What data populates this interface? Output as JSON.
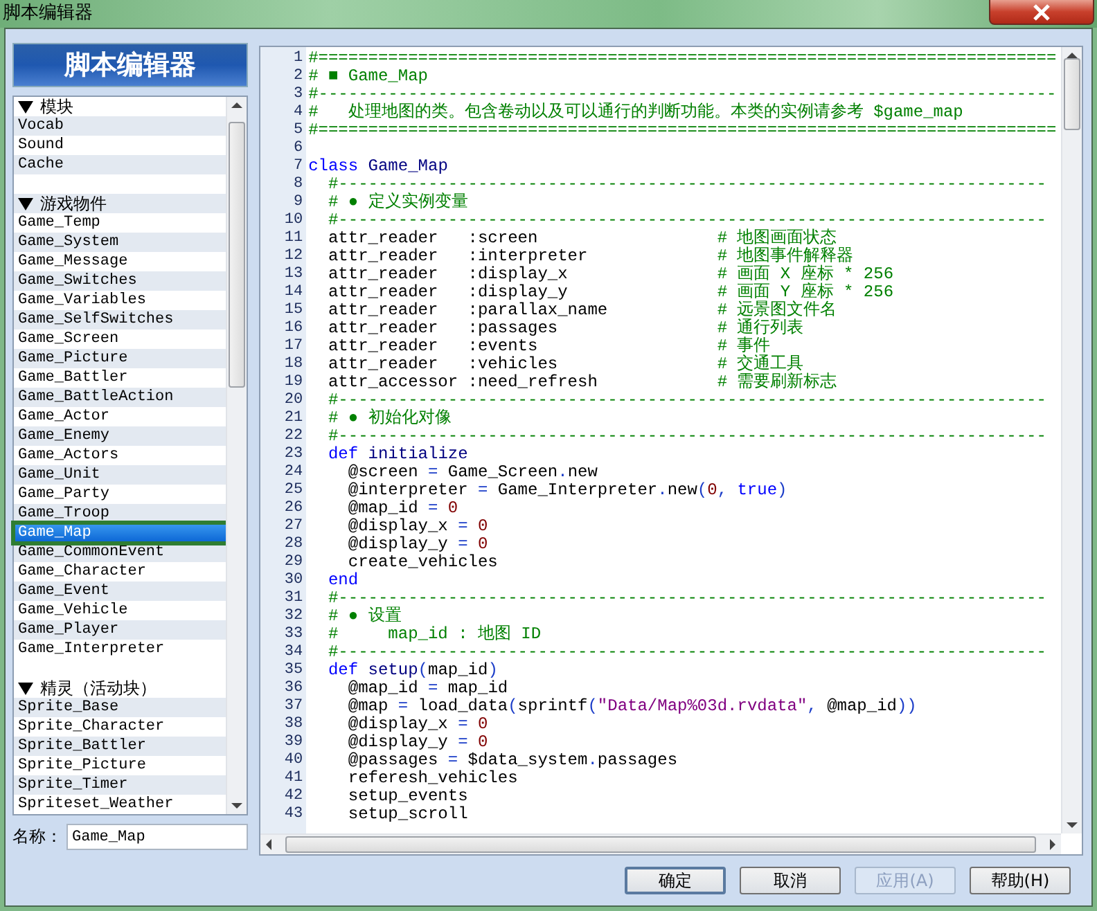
{
  "window": {
    "title": "脚本编辑器"
  },
  "script_list": {
    "header": "脚本编辑器",
    "sections": [
      {
        "heading": "模块",
        "expanded": true,
        "items": [
          {
            "name": "Vocab",
            "selected": false
          },
          {
            "name": "Sound",
            "selected": false
          },
          {
            "name": "Cache",
            "selected": false
          }
        ]
      },
      {
        "heading": "游戏物件",
        "expanded": true,
        "items": [
          {
            "name": "Game_Temp",
            "selected": false
          },
          {
            "name": "Game_System",
            "selected": false
          },
          {
            "name": "Game_Message",
            "selected": false
          },
          {
            "name": "Game_Switches",
            "selected": false
          },
          {
            "name": "Game_Variables",
            "selected": false
          },
          {
            "name": "Game_SelfSwitches",
            "selected": false
          },
          {
            "name": "Game_Screen",
            "selected": false
          },
          {
            "name": "Game_Picture",
            "selected": false
          },
          {
            "name": "Game_Battler",
            "selected": false
          },
          {
            "name": "Game_BattleAction",
            "selected": false
          },
          {
            "name": "Game_Actor",
            "selected": false
          },
          {
            "name": "Game_Enemy",
            "selected": false
          },
          {
            "name": "Game_Actors",
            "selected": false
          },
          {
            "name": "Game_Unit",
            "selected": false
          },
          {
            "name": "Game_Party",
            "selected": false
          },
          {
            "name": "Game_Troop",
            "selected": false
          },
          {
            "name": "Game_Map",
            "selected": true
          },
          {
            "name": "Game_CommonEvent",
            "selected": false
          },
          {
            "name": "Game_Character",
            "selected": false
          },
          {
            "name": "Game_Event",
            "selected": false
          },
          {
            "name": "Game_Vehicle",
            "selected": false
          },
          {
            "name": "Game_Player",
            "selected": false
          },
          {
            "name": "Game_Interpreter",
            "selected": false
          }
        ]
      },
      {
        "heading": "精灵（活动块）",
        "expanded": true,
        "items": [
          {
            "name": "Sprite_Base",
            "selected": false
          },
          {
            "name": "Sprite_Character",
            "selected": false
          },
          {
            "name": "Sprite_Battler",
            "selected": false
          },
          {
            "name": "Sprite_Picture",
            "selected": false
          },
          {
            "name": "Sprite_Timer",
            "selected": false
          },
          {
            "name": "Spriteset_Weather",
            "selected": false
          }
        ]
      }
    ]
  },
  "name_field": {
    "label": "名称：",
    "value": "Game_Map"
  },
  "editor": {
    "lines": [
      {
        "number": "1",
        "code": [
          {
            "kind": "comment",
            "text": "#=========================================================================="
          }
        ]
      },
      {
        "number": "2",
        "code": [
          {
            "kind": "comment",
            "text": "# ■ Game_Map"
          }
        ]
      },
      {
        "number": "3",
        "code": [
          {
            "kind": "comment",
            "text": "#--------------------------------------------------------------------------"
          }
        ]
      },
      {
        "number": "4",
        "code": [
          {
            "kind": "comment",
            "text": "#   处理地图的类。包含卷动以及可以通行的判断功能。本类的实例请参考 $game_map"
          }
        ]
      },
      {
        "number": "5",
        "code": [
          {
            "kind": "comment",
            "text": "#=========================================================================="
          }
        ]
      },
      {
        "number": "6"
      },
      {
        "number": "7",
        "code": [
          {
            "kind": "keyword",
            "text": "class "
          },
          {
            "kind": "name",
            "text": "Game_Map"
          }
        ]
      },
      {
        "number": "8",
        "code": [
          {
            "kind": "comment",
            "text": "  #-----------------------------------------------------------------------"
          }
        ]
      },
      {
        "number": "9",
        "code": [
          {
            "kind": "comment",
            "text": "  # ● 定义实例变量"
          }
        ]
      },
      {
        "number": "10",
        "code": [
          {
            "kind": "comment",
            "text": "  #-----------------------------------------------------------------------"
          }
        ]
      },
      {
        "number": "11",
        "code": [
          {
            "kind": "plain",
            "text": "  attr_reader   :screen                  "
          },
          {
            "kind": "comment",
            "text": "# 地图画面状态"
          }
        ]
      },
      {
        "number": "12",
        "code": [
          {
            "kind": "plain",
            "text": "  attr_reader   :interpreter             "
          },
          {
            "kind": "comment",
            "text": "# 地图事件解释器"
          }
        ]
      },
      {
        "number": "13",
        "code": [
          {
            "kind": "plain",
            "text": "  attr_reader   :display_x               "
          },
          {
            "kind": "comment",
            "text": "# 画面 X 座标 * 256"
          }
        ]
      },
      {
        "number": "14",
        "code": [
          {
            "kind": "plain",
            "text": "  attr_reader   :display_y               "
          },
          {
            "kind": "comment",
            "text": "# 画面 Y 座标 * 256"
          }
        ]
      },
      {
        "number": "15",
        "code": [
          {
            "kind": "plain",
            "text": "  attr_reader   :parallax_name           "
          },
          {
            "kind": "comment",
            "text": "# 远景图文件名"
          }
        ]
      },
      {
        "number": "16",
        "code": [
          {
            "kind": "plain",
            "text": "  attr_reader   :passages                "
          },
          {
            "kind": "comment",
            "text": "# 通行列表"
          }
        ]
      },
      {
        "number": "17",
        "code": [
          {
            "kind": "plain",
            "text": "  attr_reader   :events                  "
          },
          {
            "kind": "comment",
            "text": "# 事件"
          }
        ]
      },
      {
        "number": "18",
        "code": [
          {
            "kind": "plain",
            "text": "  attr_reader   :vehicles                "
          },
          {
            "kind": "comment",
            "text": "# 交通工具"
          }
        ]
      },
      {
        "number": "19",
        "code": [
          {
            "kind": "plain",
            "text": "  attr_accessor :need_refresh            "
          },
          {
            "kind": "comment",
            "text": "# 需要刷新标志"
          }
        ]
      },
      {
        "number": "20",
        "code": [
          {
            "kind": "comment",
            "text": "  #-----------------------------------------------------------------------"
          }
        ]
      },
      {
        "number": "21",
        "code": [
          {
            "kind": "comment",
            "text": "  # ● 初始化对像"
          }
        ]
      },
      {
        "number": "22",
        "code": [
          {
            "kind": "comment",
            "text": "  #-----------------------------------------------------------------------"
          }
        ]
      },
      {
        "number": "23",
        "code": [
          {
            "kind": "keyword",
            "text": "  def "
          },
          {
            "kind": "name",
            "text": "initialize"
          }
        ]
      },
      {
        "number": "24",
        "code": [
          {
            "kind": "plain",
            "text": "    @screen "
          },
          {
            "kind": "operator",
            "text": "="
          },
          {
            "kind": "plain",
            "text": " Game_Screen"
          },
          {
            "kind": "operator",
            "text": "."
          },
          {
            "kind": "plain",
            "text": "new"
          }
        ]
      },
      {
        "number": "25",
        "code": [
          {
            "kind": "plain",
            "text": "    @interpreter "
          },
          {
            "kind": "operator",
            "text": "="
          },
          {
            "kind": "plain",
            "text": " Game_Interpreter"
          },
          {
            "kind": "operator",
            "text": "."
          },
          {
            "kind": "plain",
            "text": "new"
          },
          {
            "kind": "operator",
            "text": "("
          },
          {
            "kind": "number",
            "text": "0"
          },
          {
            "kind": "operator",
            "text": ", "
          },
          {
            "kind": "keyword",
            "text": "true"
          },
          {
            "kind": "operator",
            "text": ")"
          }
        ]
      },
      {
        "number": "26",
        "code": [
          {
            "kind": "plain",
            "text": "    @map_id "
          },
          {
            "kind": "operator",
            "text": "= "
          },
          {
            "kind": "number",
            "text": "0"
          }
        ]
      },
      {
        "number": "27",
        "code": [
          {
            "kind": "plain",
            "text": "    @display_x "
          },
          {
            "kind": "operator",
            "text": "= "
          },
          {
            "kind": "number",
            "text": "0"
          }
        ]
      },
      {
        "number": "28",
        "code": [
          {
            "kind": "plain",
            "text": "    @display_y "
          },
          {
            "kind": "operator",
            "text": "= "
          },
          {
            "kind": "number",
            "text": "0"
          }
        ]
      },
      {
        "number": "29",
        "code": [
          {
            "kind": "plain",
            "text": "    create_vehicles"
          }
        ]
      },
      {
        "number": "30",
        "code": [
          {
            "kind": "keyword",
            "text": "  end"
          }
        ]
      },
      {
        "number": "31",
        "code": [
          {
            "kind": "comment",
            "text": "  #-----------------------------------------------------------------------"
          }
        ]
      },
      {
        "number": "32",
        "code": [
          {
            "kind": "comment",
            "text": "  # ● 设置"
          }
        ]
      },
      {
        "number": "33",
        "code": [
          {
            "kind": "comment",
            "text": "  #     map_id : 地图 ID"
          }
        ]
      },
      {
        "number": "34",
        "code": [
          {
            "kind": "comment",
            "text": "  #-----------------------------------------------------------------------"
          }
        ]
      },
      {
        "number": "35",
        "code": [
          {
            "kind": "keyword",
            "text": "  def "
          },
          {
            "kind": "name",
            "text": "setup"
          },
          {
            "kind": "operator",
            "text": "("
          },
          {
            "kind": "plain",
            "text": "map_id"
          },
          {
            "kind": "operator",
            "text": ")"
          }
        ]
      },
      {
        "number": "36",
        "code": [
          {
            "kind": "plain",
            "text": "    @map_id "
          },
          {
            "kind": "operator",
            "text": "="
          },
          {
            "kind": "plain",
            "text": " map_id"
          }
        ]
      },
      {
        "number": "37",
        "code": [
          {
            "kind": "plain",
            "text": "    @map "
          },
          {
            "kind": "operator",
            "text": "="
          },
          {
            "kind": "plain",
            "text": " load_data"
          },
          {
            "kind": "operator",
            "text": "("
          },
          {
            "kind": "plain",
            "text": "sprintf"
          },
          {
            "kind": "operator",
            "text": "("
          },
          {
            "kind": "string",
            "text": "\"Data/Map%03d.rvdata\""
          },
          {
            "kind": "operator",
            "text": ", "
          },
          {
            "kind": "plain",
            "text": "@map_id"
          },
          {
            "kind": "operator",
            "text": "))"
          }
        ]
      },
      {
        "number": "38",
        "code": [
          {
            "kind": "plain",
            "text": "    @display_x "
          },
          {
            "kind": "operator",
            "text": "= "
          },
          {
            "kind": "number",
            "text": "0"
          }
        ]
      },
      {
        "number": "39",
        "code": [
          {
            "kind": "plain",
            "text": "    @display_y "
          },
          {
            "kind": "operator",
            "text": "= "
          },
          {
            "kind": "number",
            "text": "0"
          }
        ]
      },
      {
        "number": "40",
        "code": [
          {
            "kind": "plain",
            "text": "    @passages "
          },
          {
            "kind": "operator",
            "text": "="
          },
          {
            "kind": "plain",
            "text": " $data_system"
          },
          {
            "kind": "operator",
            "text": "."
          },
          {
            "kind": "plain",
            "text": "passages"
          }
        ]
      },
      {
        "number": "41",
        "code": [
          {
            "kind": "plain",
            "text": "    referesh_vehicles"
          }
        ]
      },
      {
        "number": "42",
        "code": [
          {
            "kind": "plain",
            "text": "    setup_events"
          }
        ]
      },
      {
        "number": "43",
        "code": [
          {
            "kind": "plain",
            "text": "    setup_scroll"
          }
        ]
      }
    ]
  },
  "buttons": [
    {
      "label": "确定",
      "default": true,
      "disabled": false
    },
    {
      "label": "取消",
      "default": false,
      "disabled": false
    },
    {
      "label": "应用(A)",
      "default": false,
      "disabled": true
    },
    {
      "label": "帮助(H)",
      "default": false,
      "disabled": false
    }
  ]
}
